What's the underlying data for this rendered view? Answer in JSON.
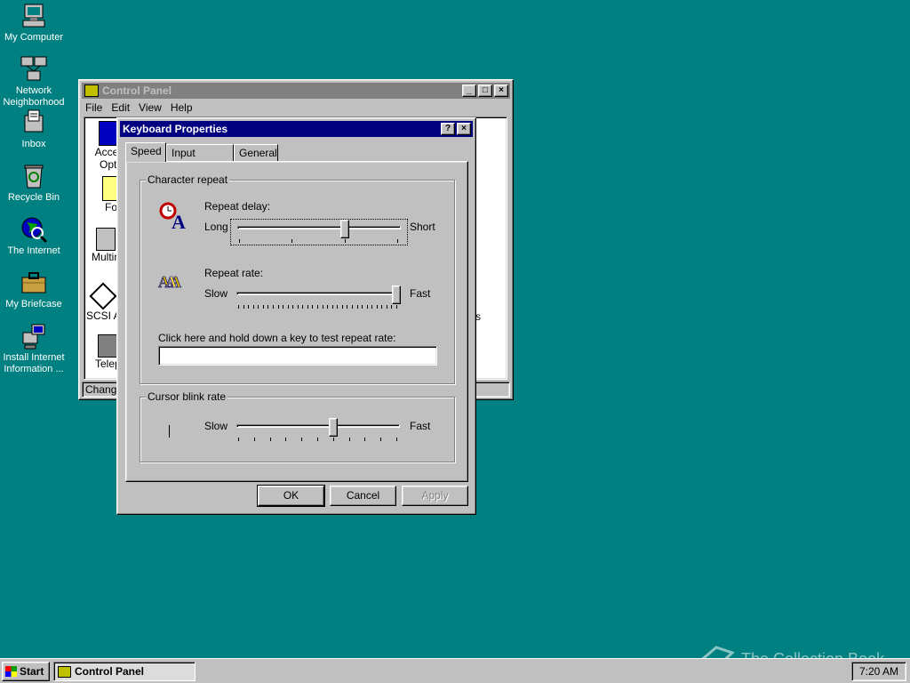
{
  "desktop": {
    "icons": [
      {
        "label": "My Computer",
        "icon": "my-computer-icon"
      },
      {
        "label": "Network Neighborhood",
        "icon": "network-icon"
      },
      {
        "label": "Inbox",
        "icon": "inbox-icon"
      },
      {
        "label": "Recycle Bin",
        "icon": "recycle-bin-icon"
      },
      {
        "label": "The Internet",
        "icon": "internet-icon"
      },
      {
        "label": "My Briefcase",
        "icon": "briefcase-icon"
      },
      {
        "label": "Install Internet Information ...",
        "icon": "install-icon"
      }
    ],
    "watermark": "The Collection Book",
    "colors": {
      "desktop": "#008080",
      "active_title": "#000080",
      "inactive_title": "#808080",
      "face": "#c0c0c0"
    }
  },
  "control_panel": {
    "title": "Control Panel",
    "menu": [
      "File",
      "Edit",
      "View",
      "Help"
    ],
    "items": [
      "Acces",
      "Opti",
      "Fo",
      "Multin",
      "SCSI A",
      "Telep",
      "s"
    ],
    "status": "Change"
  },
  "keyboard": {
    "title": "Keyboard Properties",
    "tabs": [
      "Speed",
      "Input Locales",
      "General"
    ],
    "selected_tab": "Speed",
    "char_repeat": {
      "legend": "Character repeat",
      "delay_label": "Repeat delay:",
      "delay_min": "Long",
      "delay_max": "Short",
      "delay_level": 0.67,
      "rate_label": "Repeat rate:",
      "rate_min": "Slow",
      "rate_max": "Fast",
      "rate_level": 1.0,
      "test_label": "Click here and hold down a key to test repeat rate:",
      "test_value": ""
    },
    "cursor_blink": {
      "legend": "Cursor blink rate",
      "min": "Slow",
      "max": "Fast",
      "level": 0.6
    },
    "buttons": {
      "ok": "OK",
      "cancel": "Cancel",
      "apply": "Apply"
    }
  },
  "taskbar": {
    "start": "Start",
    "task": "Control Panel",
    "clock": "7:20 AM"
  }
}
